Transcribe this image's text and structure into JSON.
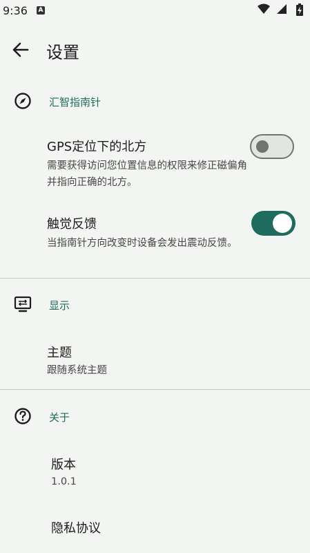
{
  "status_bar": {
    "time": "9:36",
    "notification_icon_letter": "A",
    "icons": [
      "wifi-icon",
      "signal-icon",
      "battery-icon"
    ]
  },
  "app_bar": {
    "back_icon": "arrow-back-icon",
    "title": "设置"
  },
  "sections": {
    "compass": {
      "icon": "compass-icon",
      "title": "汇智指南针",
      "items": [
        {
          "title": "GPS定位下的北方",
          "summary": "需要获得访问您位置信息的权限来修正磁偏角并指向正确的北方。",
          "switch_on": false
        },
        {
          "title": "触觉反馈",
          "summary": "当指南针方向改变时设备会发出震动反馈。",
          "switch_on": true
        }
      ]
    },
    "display": {
      "icon": "display-settings-icon",
      "title": "显示",
      "items": [
        {
          "title": "主题",
          "summary": "跟随系统主题"
        }
      ]
    },
    "about": {
      "icon": "help-icon",
      "title": "关于",
      "items": [
        {
          "title": "版本",
          "summary": "1.0.1"
        },
        {
          "title": "隐私协议"
        }
      ]
    }
  },
  "colors": {
    "background": "#f2f5f1",
    "accent": "#1e6c5e",
    "switch_off_track": "#e2e5e1",
    "switch_off_outline": "#707570",
    "divider": "#c8ccc7"
  }
}
